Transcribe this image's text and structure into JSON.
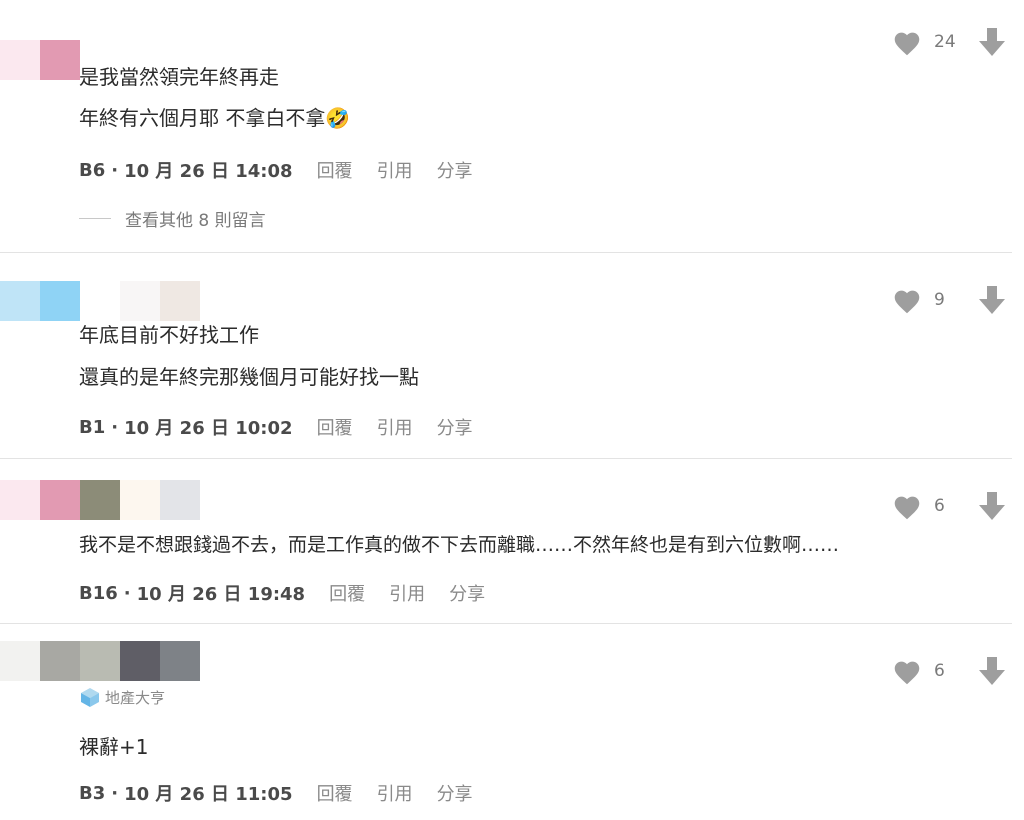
{
  "colors": {
    "heart": "#9e9e9e",
    "arrow": "#9e9e9e",
    "divider": "#e3e3e3",
    "badge_icon_top": "#b0d9ef",
    "badge_icon_side": "#64b5e6"
  },
  "icons": {
    "like": "heart-icon",
    "dislike": "arrow-down-icon",
    "badge": "house-icon"
  },
  "comments": [
    {
      "avatar_colors": [
        "#fbe8ef",
        "#e29ab2"
      ],
      "likes": "24",
      "lines": [
        "是我當然領完年終再走",
        "年終有六個月耶 不拿白不拿🤣"
      ],
      "floor": "B6",
      "separator": "·",
      "date": "10 月 26 日 14:08",
      "reply": "回覆",
      "quote": "引用",
      "share": "分享",
      "more_replies": "查看其他 8 則留言"
    },
    {
      "avatar_colors": [
        "#bfe4f7",
        "#8fd3f5",
        "#ffffff",
        "#f8f6f6",
        "#efe8e3"
      ],
      "likes": "9",
      "lines": [
        "年底目前不好找工作",
        "還真的是年終完那幾個月可能好找一點"
      ],
      "floor": "B1",
      "separator": "·",
      "date": "10 月 26 日 10:02",
      "reply": "回覆",
      "quote": "引用",
      "share": "分享"
    },
    {
      "avatar_colors": [
        "#fbe8ef",
        "#e29ab2",
        "#8c8c78",
        "#fdf7ef",
        "#e3e4e8"
      ],
      "likes": "6",
      "lines": [
        "我不是不想跟錢過不去，而是工作真的做不下去而離職……不然年終也是有到六位數啊……"
      ],
      "floor": "B16",
      "separator": "·",
      "date": "10 月 26 日 19:48",
      "reply": "回覆",
      "quote": "引用",
      "share": "分享"
    },
    {
      "avatar_colors": [
        "#f2f2f0",
        "#a8a8a3",
        "#b9bbb2",
        "#5f5e66",
        "#7e8287"
      ],
      "likes": "6",
      "badge": "地產大亨",
      "lines": [
        "裸辭+1"
      ],
      "floor": "B3",
      "separator": "·",
      "date": "10 月 26 日 11:05",
      "reply": "回覆",
      "quote": "引用",
      "share": "分享"
    }
  ]
}
